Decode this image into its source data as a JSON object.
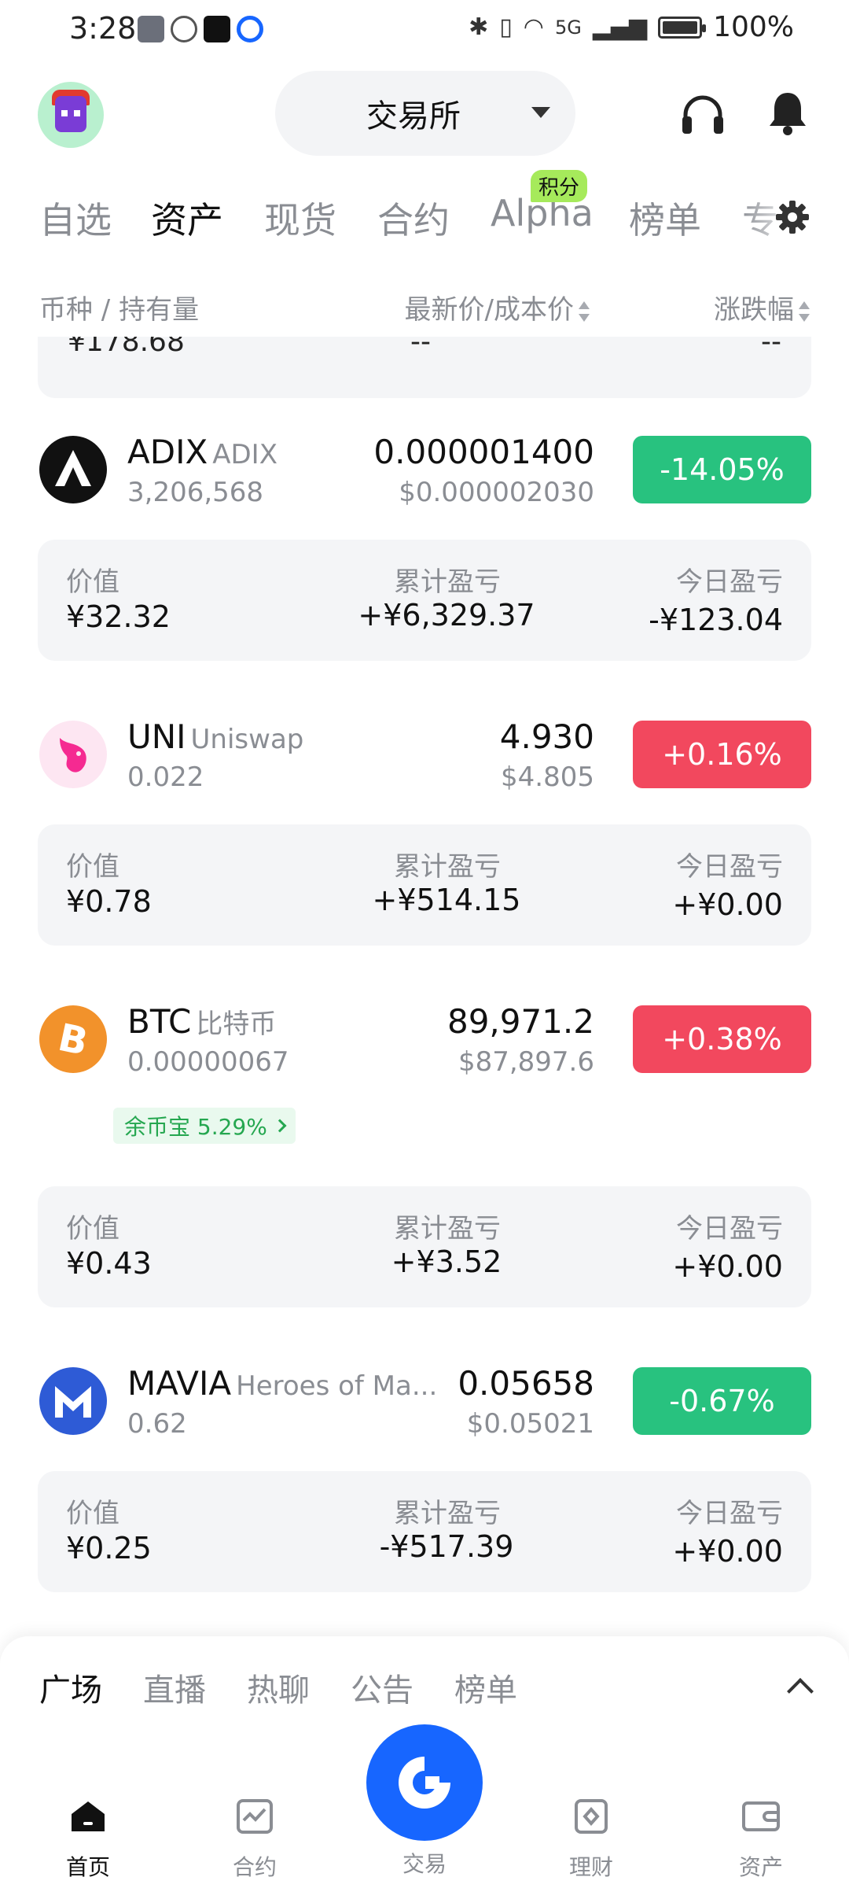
{
  "status_bar": {
    "time": "3:28",
    "battery_text": "100%",
    "network": "5G",
    "battery_level": 1.0
  },
  "header": {
    "exchange_label": "交易所"
  },
  "tabs": [
    {
      "label": "自选",
      "active": false
    },
    {
      "label": "资产",
      "active": true
    },
    {
      "label": "现货",
      "active": false
    },
    {
      "label": "合约",
      "active": false
    },
    {
      "label": "Alpha",
      "active": false,
      "badge": "积分"
    },
    {
      "label": "榜单",
      "active": false
    },
    {
      "label": "专",
      "active": false
    }
  ],
  "columns": {
    "asset": "币种 / 持有量",
    "price": "最新价/成本价",
    "change": "涨跌幅"
  },
  "previous_row": {
    "value": "¥178.68",
    "pnl": "--",
    "today": "--"
  },
  "assets": [
    {
      "symbol": "ADIX",
      "full_name": "ADIX",
      "quantity": "3,206,568",
      "price": "0.000001400",
      "cost": "$0.000002030",
      "change": "-14.05%",
      "direction": "down",
      "details": {
        "value_label": "价值",
        "value": "¥32.32",
        "pnl_label": "累计盈亏",
        "pnl": "+¥6,329.37",
        "today_label": "今日盈亏",
        "today": "-¥123.04"
      }
    },
    {
      "symbol": "UNI",
      "full_name": "Uniswap",
      "quantity": "0.022",
      "price": "4.930",
      "cost": "$4.805",
      "change": "+0.16%",
      "direction": "up",
      "details": {
        "value_label": "价值",
        "value": "¥0.78",
        "pnl_label": "累计盈亏",
        "pnl": "+¥514.15",
        "today_label": "今日盈亏",
        "today": "+¥0.00"
      }
    },
    {
      "symbol": "BTC",
      "full_name": "比特币",
      "quantity": "0.00000067",
      "price": "89,971.2",
      "cost": "$87,897.6",
      "change": "+0.38%",
      "direction": "up",
      "earn_tag": "余币宝 5.29%",
      "details": {
        "value_label": "价值",
        "value": "¥0.43",
        "pnl_label": "累计盈亏",
        "pnl": "+¥3.52",
        "today_label": "今日盈亏",
        "today": "+¥0.00"
      }
    },
    {
      "symbol": "MAVIA",
      "full_name": "Heroes of Ma...",
      "quantity": "0.62",
      "price": "0.05658",
      "cost": "$0.05021",
      "change": "-0.67%",
      "direction": "down",
      "details": {
        "value_label": "价值",
        "value": "¥0.25",
        "pnl_label": "累计盈亏",
        "pnl": "-¥517.39",
        "today_label": "今日盈亏",
        "today": "+¥0.00"
      }
    }
  ],
  "feed_tabs": [
    "广场",
    "直播",
    "热聊",
    "公告",
    "榜单"
  ],
  "bottom_nav": [
    {
      "label": "首页",
      "icon": "home-icon",
      "active": true
    },
    {
      "label": "合约",
      "icon": "futures-chart-icon",
      "active": false
    },
    {
      "label": "交易",
      "icon": "trade-logo-icon",
      "active": false
    },
    {
      "label": "理财",
      "icon": "earn-icon",
      "active": false
    },
    {
      "label": "资产",
      "icon": "wallet-icon",
      "active": false
    }
  ],
  "colors": {
    "up": "#f2485e",
    "down": "#28c27f",
    "accent": "#1766ff",
    "badge": "#a6ea5b"
  }
}
